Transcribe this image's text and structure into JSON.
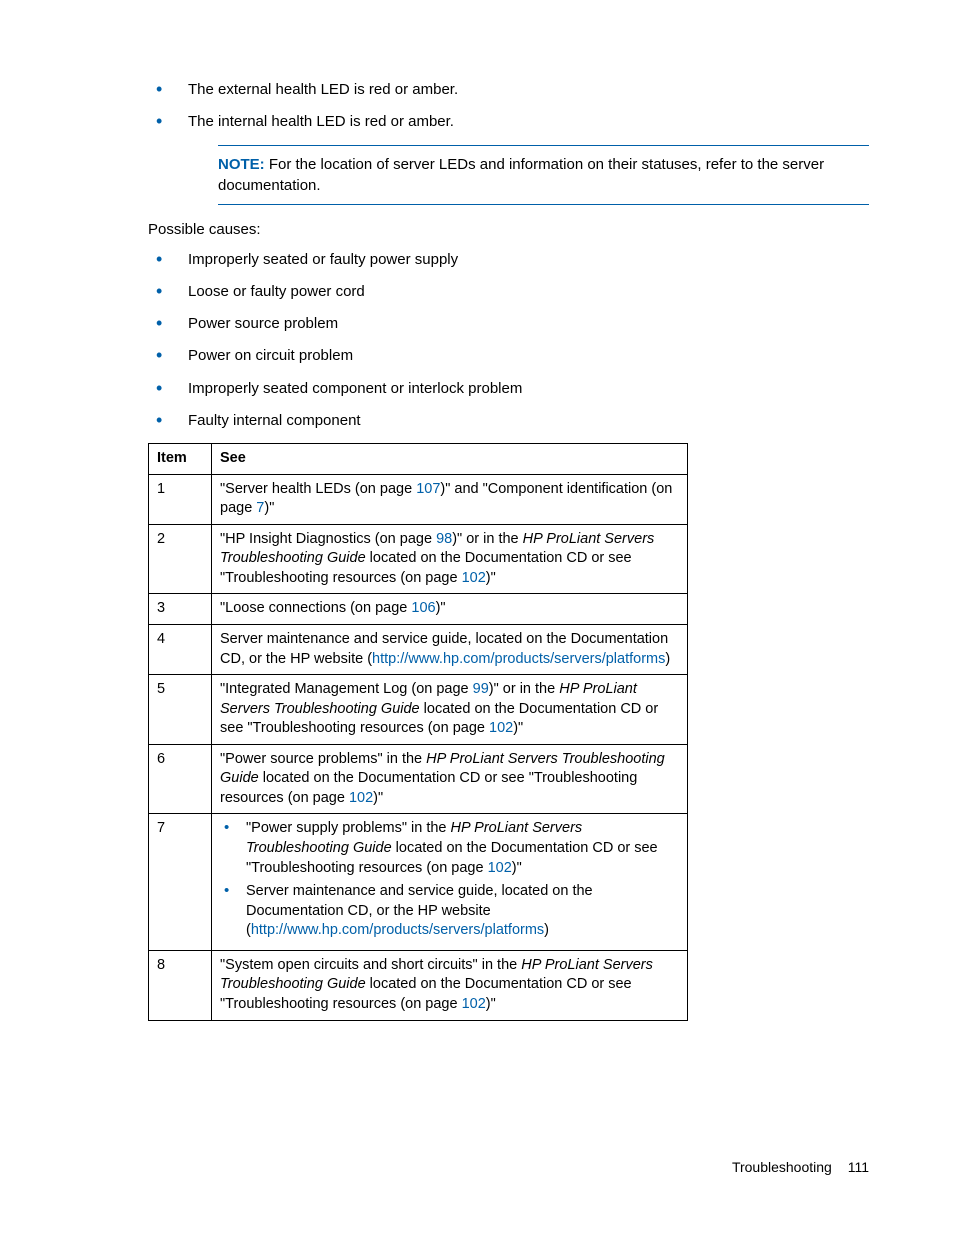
{
  "bullets_top": [
    "The external health LED is red or amber.",
    "The internal health LED is red or amber."
  ],
  "note": {
    "label": "NOTE:",
    "text": "  For the location of server LEDs and information on their statuses, refer to the server documentation."
  },
  "section_label": "Possible causes:",
  "causes": [
    "Improperly seated or faulty power supply",
    "Loose or faulty power cord",
    "Power source problem",
    "Power on circuit problem",
    "Improperly seated component or interlock problem",
    "Faulty internal component"
  ],
  "table": {
    "headers": [
      "Item",
      "See"
    ],
    "rows": {
      "r1": {
        "item": "1",
        "t1": "\"Server health LEDs (on page ",
        "l1": "107",
        "t2": ")\" and \"Component identification (on page ",
        "l2": "7",
        "t3": ")\""
      },
      "r2": {
        "item": "2",
        "t1": "\"HP Insight Diagnostics (on page ",
        "l1": "98",
        "t2": ")\" or in the ",
        "i1": "HP ProLiant Servers Troubleshooting Guide",
        "t3": " located on the Documentation CD or see \"Troubleshooting resources (on page ",
        "l2": "102",
        "t4": ")\""
      },
      "r3": {
        "item": "3",
        "t1": "\"Loose connections (on page ",
        "l1": "106",
        "t2": ")\""
      },
      "r4": {
        "item": "4",
        "t1": "Server maintenance and service guide, located on the Documentation CD, or the HP website (",
        "l1": "http://www.hp.com/products/servers/platforms",
        "t2": ")"
      },
      "r5": {
        "item": "5",
        "t1": "\"Integrated Management Log (on page ",
        "l1": "99",
        "t2": ")\" or in the ",
        "i1": "HP ProLiant Servers Troubleshooting Guide",
        "t3": " located on the Documentation CD or see \"Troubleshooting resources (on page ",
        "l2": "102",
        "t4": ")\""
      },
      "r6": {
        "item": "6",
        "t1": "\"Power source problems\" in the ",
        "i1": "HP ProLiant Servers Troubleshooting Guide",
        "t2": " located on the Documentation CD or see \"Troubleshooting resources (on page ",
        "l1": "102",
        "t3": ")\""
      },
      "r7": {
        "item": "7",
        "b1_t1": "\"Power supply problems\" in the ",
        "b1_i1": "HP ProLiant Servers Troubleshooting Guide",
        "b1_t2": " located on the Documentation CD or see \"Troubleshooting resources (on page ",
        "b1_l1": "102",
        "b1_t3": ")\"",
        "b2_t1": "Server maintenance and service guide, located on the Documentation CD, or the HP website (",
        "b2_l1": "http://www.hp.com/products/servers/platforms",
        "b2_t2": ")"
      },
      "r8": {
        "item": "8",
        "t1": "\"System open circuits and short circuits\" in the ",
        "i1": "HP ProLiant Servers Troubleshooting Guide",
        "t2": " located on the Documentation CD or see \"Troubleshooting resources (on page ",
        "l1": "102",
        "t3": ")\""
      }
    }
  },
  "footer": {
    "section": "Troubleshooting",
    "page": "111"
  }
}
